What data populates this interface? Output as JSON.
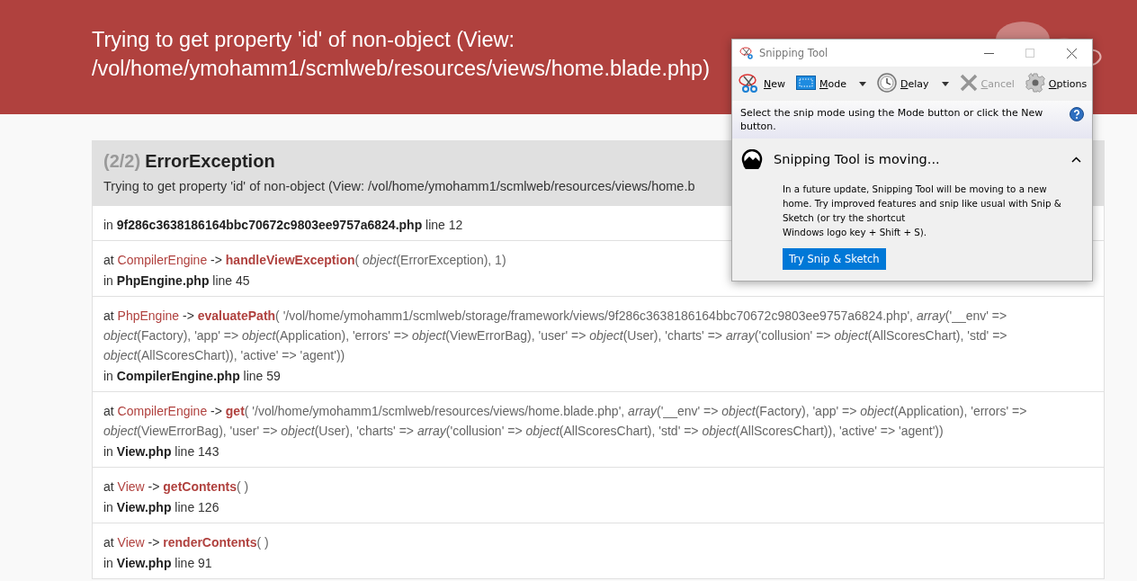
{
  "header": {
    "title": "Trying to get property 'id' of non-object (View: /vol/home/ymohamm1/scmlweb/resources/views/home.blade.php)"
  },
  "exception": {
    "counter": "(2/2)",
    "name": "ErrorException",
    "message": "Trying to get property 'id' of non-object (View: /vol/home/ymohamm1/scmlweb/resources/views/home.b",
    "location": "in **9f286c3638186164bbc70672c9803ee9757a6824.php** line 12"
  },
  "frames": [
    {
      "at": "at",
      "class": "CompilerEngine",
      "arrow": "->",
      "method": "handleViewException",
      "args": "( *object*(ErrorException), 1)",
      "location": "in **PhpEngine.php** line 45"
    },
    {
      "at": "at",
      "class": "PhpEngine",
      "arrow": "->",
      "method": "evaluatePath",
      "args": "( '/vol/home/ymohamm1/scmlweb/storage/framework/views/9f286c3638186164bbc70672c9803ee9757a6824.php', *array*('__env' => *object*(Factory), 'app' => *object*(Application), 'errors' => *object*(ViewErrorBag), 'user' => *object*(User), 'charts' => *array*('collusion' => *object*(AllScoresChart), 'std' => *object*(AllScoresChart)), 'active' => 'agent'))",
      "location": "in **CompilerEngine.php** line 59"
    },
    {
      "at": "at",
      "class": "CompilerEngine",
      "arrow": "->",
      "method": "get",
      "args": "( '/vol/home/ymohamm1/scmlweb/resources/views/home.blade.php', *array*('__env' => *object*(Factory), 'app' => *object*(Application), 'errors' => *object*(ViewErrorBag), 'user' => *object*(User), 'charts' => *array*('collusion' => *object*(AllScoresChart), 'std' => *object*(AllScoresChart)), 'active' => 'agent'))",
      "location": "in **View.php** line 143"
    },
    {
      "at": "at",
      "class": "View",
      "arrow": "->",
      "method": "getContents",
      "args": "( )",
      "location": "in **View.php** line 126"
    },
    {
      "at": "at",
      "class": "View",
      "arrow": "->",
      "method": "renderContents",
      "args": "( )",
      "location": "in **View.php** line 91"
    }
  ],
  "snipping_tool": {
    "title": "Snipping Tool",
    "toolbar": [
      {
        "kind": "new",
        "label": "New",
        "disabled": false
      },
      {
        "kind": "mode",
        "label": "Mode",
        "disabled": false
      },
      {
        "kind": "delay",
        "label": "Delay",
        "disabled": false
      },
      {
        "kind": "cancel",
        "label": "Cancel",
        "disabled": true
      },
      {
        "kind": "options",
        "label": "Options",
        "disabled": false
      }
    ],
    "hint": "Select the snip mode using the Mode button or click the New button.",
    "notice": {
      "title": "Snipping Tool is moving...",
      "expanded": true,
      "body": "In a future update, Snipping Tool will be moving to a new home. Try improved features and snip like usual with Snip & Sketch (or try the shortcut\nWindows logo key + Shift + S).",
      "button": "Try Snip & Sketch"
    }
  }
}
